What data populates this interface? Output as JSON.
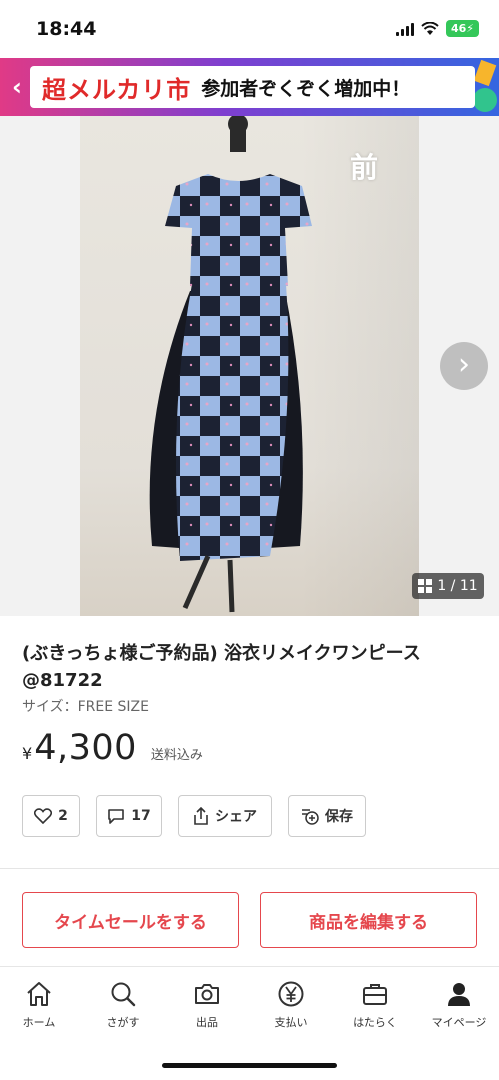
{
  "status_bar": {
    "time": "18:44",
    "battery": "46"
  },
  "banner": {
    "logo": "超メルカリ市",
    "text": "参加者ぞくぞく増加中！"
  },
  "photo": {
    "caption": "前",
    "counter": "1 / 11"
  },
  "product": {
    "title": "(ぶきっちょ様ご予約品) 浴衣リメイクワンピース @81722",
    "size": "サイズ：FREE SIZE",
    "currency": "¥",
    "price": "4,300",
    "shipping": "送料込み"
  },
  "actions": {
    "likes": "2",
    "comments": "17",
    "share": "シェア",
    "save": "保存"
  },
  "buttons": {
    "time_sale": "タイムセールをする",
    "edit": "商品を編集する"
  },
  "tab_bar": {
    "home": "ホーム",
    "search": "さがす",
    "listing": "出品",
    "payment": "支払い",
    "work": "はたらく",
    "mypage": "マイページ"
  }
}
